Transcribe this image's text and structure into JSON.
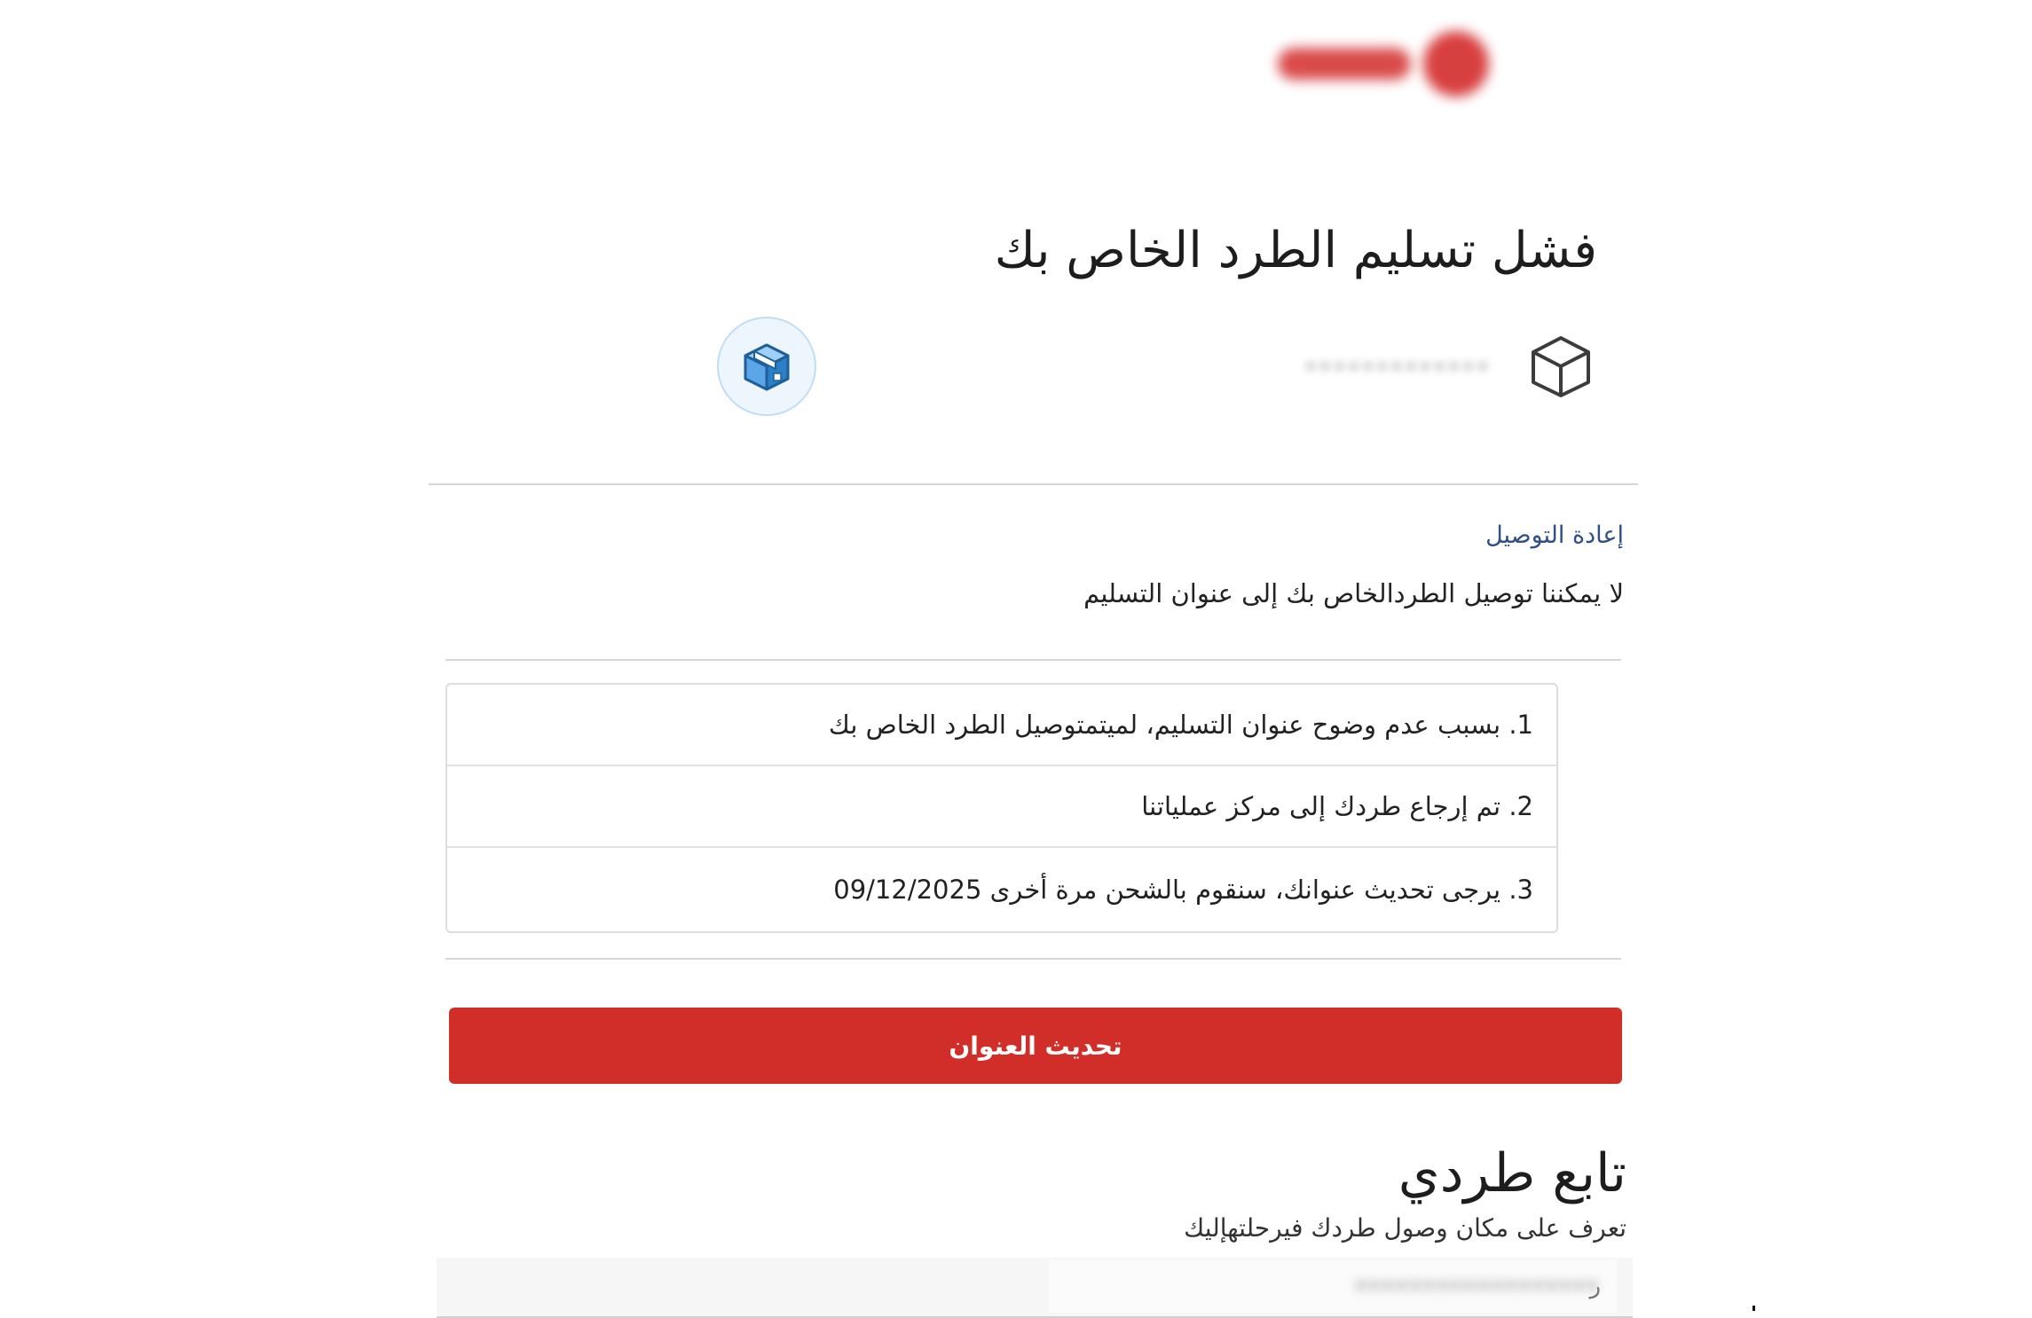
{
  "header": {
    "logo_name": "brand-logo"
  },
  "shipment": {
    "title": "فشل تسليم الطرد الخاص بك",
    "tracking_number": "•••••••••••••"
  },
  "redelivery": {
    "label": "إعادة التوصيل",
    "description": "لا يمكننا توصيل الطردالخاص بك إلى عنوان التسليم"
  },
  "reasons": [
    {
      "text": "1. بسبب عدم وضوح عنوان التسليم، لميتمتوصيل الطرد الخاص بك"
    },
    {
      "text": "2. تم إرجاع طردك إلى مركز عملياتنا"
    },
    {
      "text": "3. يرجى تحديث عنوانك، سنقوم بالشحن مرة أخرى 09/12/2025"
    }
  ],
  "actions": {
    "update_address_label": "تحديث العنوان"
  },
  "tracking": {
    "title": "تابع طردي",
    "subtitle": "تعرف على مكان وصول طردك فيرحلتهإليك",
    "input_value": "ر",
    "input_blurred": "••••••••••••••••••"
  },
  "colors": {
    "accent_red": "#d12e29",
    "label_blue": "#2f4f86",
    "icon_blue": "#2d7fc5"
  },
  "icons": {
    "box": "box-outline-icon",
    "status": "package-blue-icon"
  }
}
